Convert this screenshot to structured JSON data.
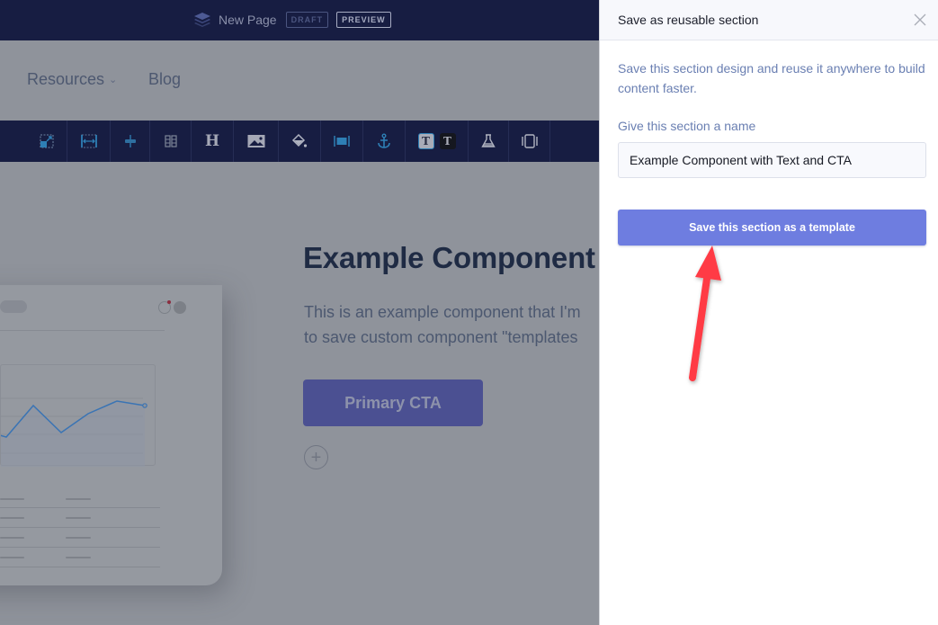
{
  "editor": {
    "topbar": {
      "page_name": "New Page",
      "draft_badge": "DRAFT",
      "preview_badge": "PREVIEW"
    },
    "nav": {
      "items": [
        {
          "label": "Resources",
          "has_dropdown": true
        },
        {
          "label": "Blog",
          "has_dropdown": false
        }
      ]
    },
    "toolbar": {
      "tools": [
        {
          "icon": "resize-icon"
        },
        {
          "icon": "section-height-icon"
        },
        {
          "icon": "vertical-align-icon"
        },
        {
          "icon": "columns-icon"
        },
        {
          "icon": "heading-icon",
          "glyph": "H"
        },
        {
          "icon": "image-icon"
        },
        {
          "icon": "fill-color-icon"
        },
        {
          "icon": "full-width-icon"
        },
        {
          "icon": "anchor-icon"
        },
        {
          "icon": "text-style-light-icon",
          "glyph": "T"
        },
        {
          "icon": "text-style-dark-icon",
          "glyph": "T"
        },
        {
          "icon": "ab-test-flask-icon"
        },
        {
          "icon": "container-icon"
        }
      ],
      "colors": {
        "background": "#171d42",
        "accent": "#2e7fb5"
      }
    },
    "section": {
      "heading": "Example Component",
      "body_line1": "This is an example component that I'm",
      "body_line2": "to save custom component \"templates",
      "cta_label": "Primary CTA",
      "add_block_label": "+"
    }
  },
  "panel": {
    "title": "Save as reusable section",
    "description": "Save this section design and reuse it anywhere to build content faster.",
    "name_label": "Give this section a name",
    "name_value": "Example Component with Text and CTA",
    "save_button_label": "Save this section as a template",
    "colors": {
      "primary": "#6e7de0",
      "muted_text": "#6a7fb2"
    }
  },
  "annotation": {
    "arrow_color": "#ff3b45",
    "points_to": "save-section-button"
  }
}
